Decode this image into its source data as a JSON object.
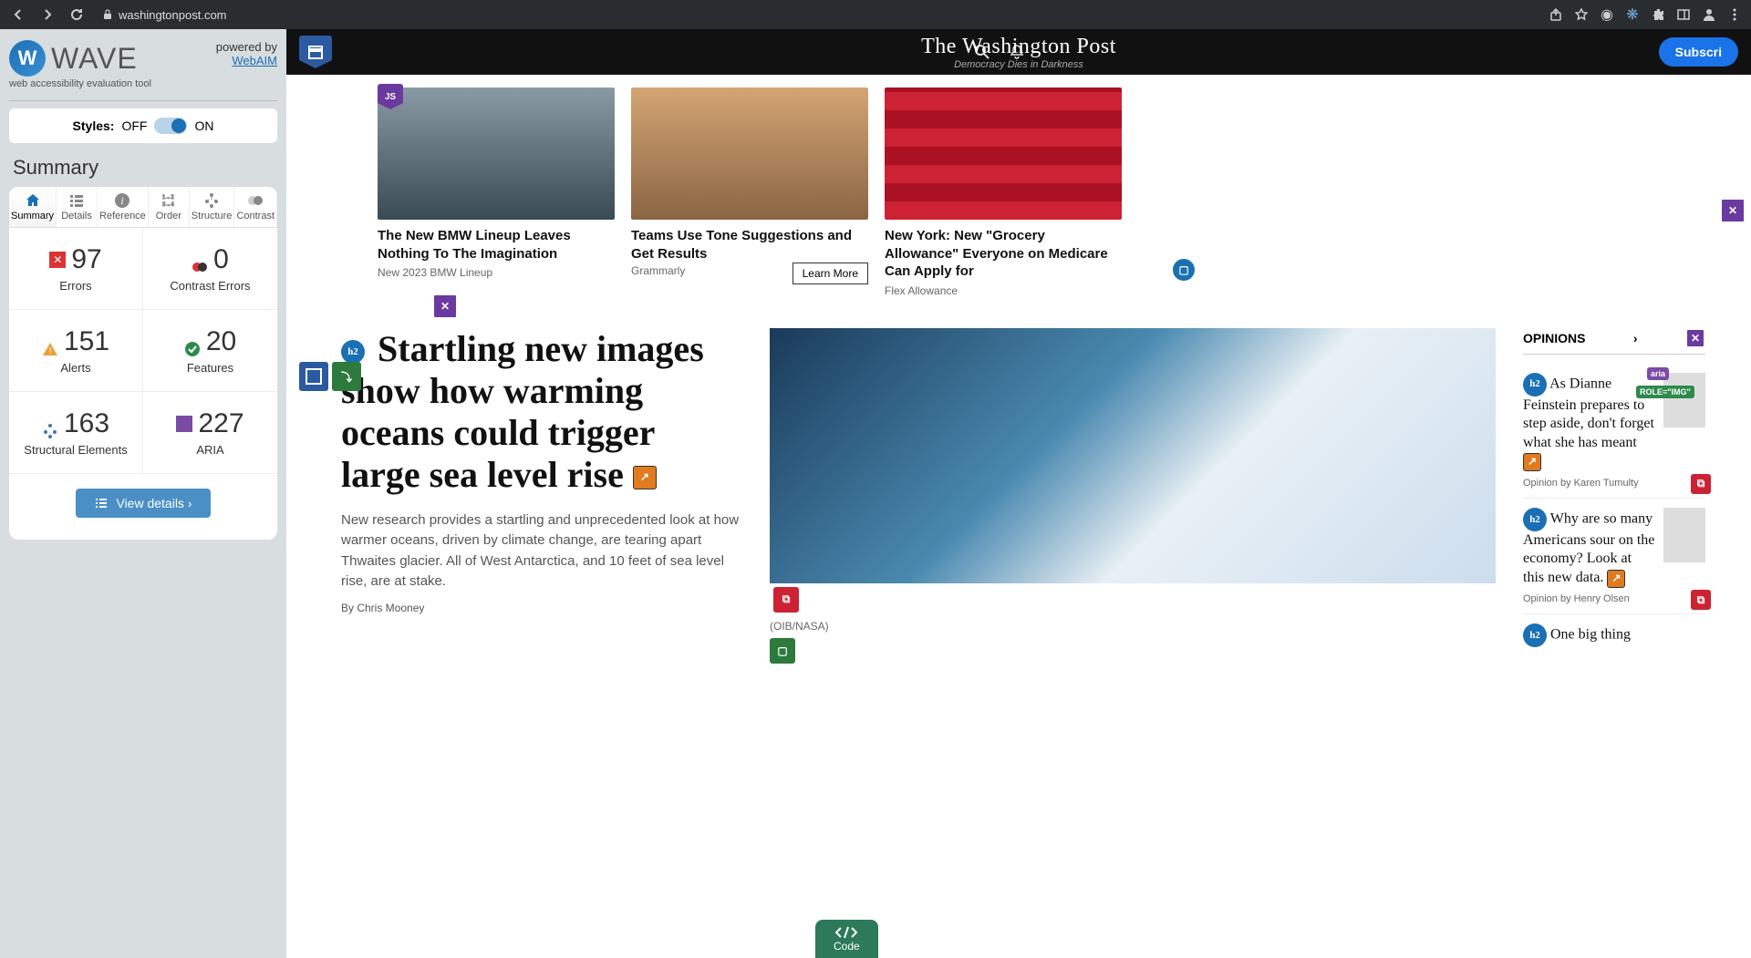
{
  "browser": {
    "url": "washingtonpost.com"
  },
  "wave": {
    "title": "WAVE",
    "subtitle": "web accessibility evaluation tool",
    "powered_label": "powered by",
    "powered_link": "WebAIM",
    "styles_label": "Styles:",
    "off": "OFF",
    "on": "ON",
    "summary_heading": "Summary",
    "tabs": {
      "summary": "Summary",
      "details": "Details",
      "reference": "Reference",
      "order": "Order",
      "structure": "Structure",
      "contrast": "Contrast"
    },
    "stats": {
      "errors": {
        "count": "97",
        "label": "Errors"
      },
      "contrast": {
        "count": "0",
        "label": "Contrast Errors"
      },
      "alerts": {
        "count": "151",
        "label": "Alerts"
      },
      "features": {
        "count": "20",
        "label": "Features"
      },
      "structural": {
        "count": "163",
        "label": "Structural Elements"
      },
      "aria": {
        "count": "227",
        "label": "ARIA"
      }
    },
    "view_details": "View details ›",
    "code_tab": "Code",
    "aria_badge": "aria",
    "role_badge": "ROLE=\"IMG\""
  },
  "wapo": {
    "masthead": "The Washington Post",
    "tagline": "Democracy Dies in Darkness",
    "subscribe": "Subscri"
  },
  "ads": [
    {
      "title": "The New BMW Lineup Leaves Nothing To The Imagination",
      "sub": "New 2023 BMW Lineup",
      "btn": ""
    },
    {
      "title": "Teams Use Tone Suggestions and Get Results",
      "sub": "Grammarly",
      "btn": "Learn More"
    },
    {
      "title": "New York: New \"Grocery Allowance\" Everyone on Medicare Can Apply for",
      "sub": "Flex Allowance",
      "btn": ""
    }
  ],
  "article": {
    "headline": "Startling new images show how warming oceans could trigger large sea level rise",
    "summary": "New research provides a startling and unprecedented look at how warmer oceans, driven by climate change, are tearing apart Thwaites glacier. All of West Antarctica, and 10 feet of sea level rise, are at stake.",
    "byline": "By Chris Mooney",
    "caption": "(OIB/NASA)"
  },
  "opinions": {
    "header": "OPINIONS",
    "items": [
      {
        "title": "As Dianne Feinstein prepares to step aside, don't forget what she has meant",
        "byline": "Opinion by Karen Tumulty"
      },
      {
        "title": "Why are so many Americans sour on the economy? Look at this new data.",
        "byline": "Opinion by Henry Olsen"
      },
      {
        "title": "One big thing",
        "byline": ""
      }
    ]
  }
}
